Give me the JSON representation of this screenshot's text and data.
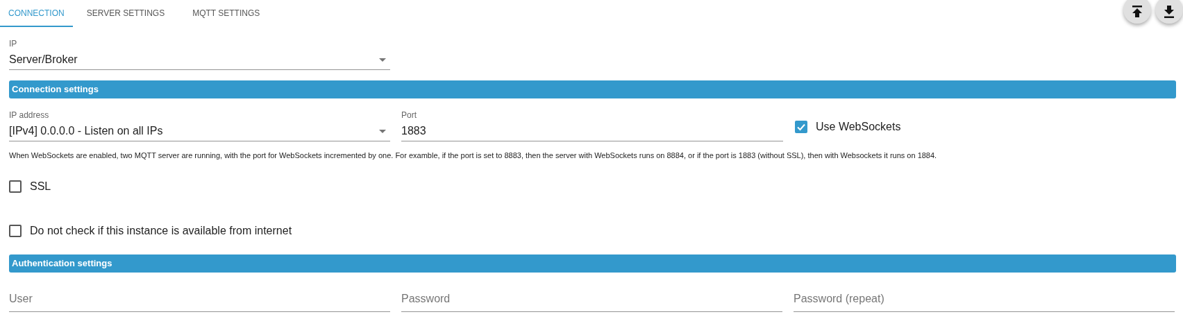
{
  "tabs": [
    {
      "label": "CONNECTION",
      "selected": true
    },
    {
      "label": "SERVER SETTINGS",
      "selected": false
    },
    {
      "label": "MQTT SETTINGS",
      "selected": false
    }
  ],
  "toolbar": [
    {
      "kind": "upload"
    },
    {
      "kind": "download"
    }
  ],
  "mode_select": {
    "label": "IP",
    "value": "Server/Broker"
  },
  "connection_settings": {
    "title": "Connection settings",
    "ip_address": {
      "label": "IP address",
      "value": "[IPv4] 0.0.0.0 - Listen on all IPs"
    },
    "port": {
      "label": "Port",
      "value": "1883"
    },
    "websockets": {
      "label": "Use WebSockets",
      "checked": true
    },
    "help": "When WebSockets are enabled, two MQTT server are running, with the port for WebSockets incremented by one. For examble, if the port is set to 8883, then the server with WebSockets runs on 8884, or if the port is 1883 (without SSL), then with Websockets it runs on 1884.",
    "ssl": {
      "label": "SSL",
      "checked": false
    },
    "no_internet_check": {
      "label": "Do not check if this instance is available from internet",
      "checked": false
    }
  },
  "authentication_settings": {
    "title": "Authentication settings",
    "fields": [
      {
        "placeholder": "User"
      },
      {
        "placeholder": "Password"
      },
      {
        "placeholder": "Password (repeat)"
      }
    ]
  }
}
